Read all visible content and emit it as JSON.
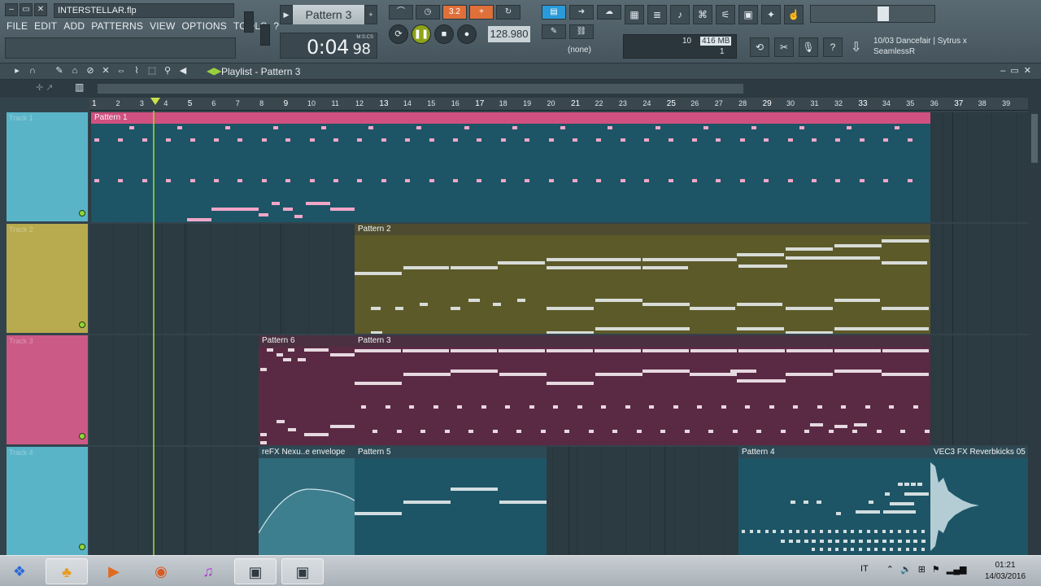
{
  "window": {
    "filename": "INTERSTELLAR.flp",
    "winbtns": [
      "–",
      "▭",
      "✕"
    ]
  },
  "menu": [
    "FILE",
    "EDIT",
    "ADD",
    "PATTERNS",
    "VIEW",
    "OPTIONS",
    "TOOLS",
    "?"
  ],
  "transport": {
    "pattern_name": "Pattern 3",
    "time_main": "0:04",
    "time_sub": "98",
    "time_label": "M:S:CS",
    "tempo": "128.980",
    "snap": "3.2",
    "mixer_route": "(none)"
  },
  "cpu": {
    "cpu_val": "10",
    "mem": "416 MB",
    "poly": "1"
  },
  "news": {
    "line1": "10/03  Dancefair | Sytrus x",
    "line2": "SeamlessR"
  },
  "playlist": {
    "title": "Playlist - Pattern 3",
    "ruler_numbers": [
      "1",
      "2",
      "3",
      "4",
      "5",
      "6",
      "7",
      "8",
      "9",
      "10",
      "11",
      "12",
      "13",
      "14",
      "15",
      "16",
      "17",
      "18",
      "19",
      "20",
      "21",
      "22",
      "23",
      "24",
      "25",
      "26",
      "27",
      "28",
      "29",
      "30",
      "31",
      "32",
      "33",
      "34",
      "35",
      "36",
      "37",
      "38",
      "39"
    ],
    "tracks": [
      {
        "label": "Track 1",
        "color": "#5ab4c8"
      },
      {
        "label": "Track 2",
        "color": "#b8aa4e"
      },
      {
        "label": "Track 3",
        "color": "#cc5a86"
      },
      {
        "label": "Track 4",
        "color": "#5ab4c8"
      }
    ],
    "clips": [
      {
        "name": "Pattern 1",
        "track": 0
      },
      {
        "name": "Pattern 2",
        "track": 1
      },
      {
        "name": "Pattern 6",
        "track": 2
      },
      {
        "name": "Pattern 3",
        "track": 2
      },
      {
        "name": "reFX Nexu..e envelope",
        "track": 3
      },
      {
        "name": "Pattern 5",
        "track": 3
      },
      {
        "name": "Pattern 4",
        "track": 3
      },
      {
        "name": "VEC3 FX Reverbkicks 05",
        "track": 3
      }
    ]
  },
  "taskbar": {
    "lang": "IT",
    "time": "01:21",
    "date": "14/03/2016"
  }
}
